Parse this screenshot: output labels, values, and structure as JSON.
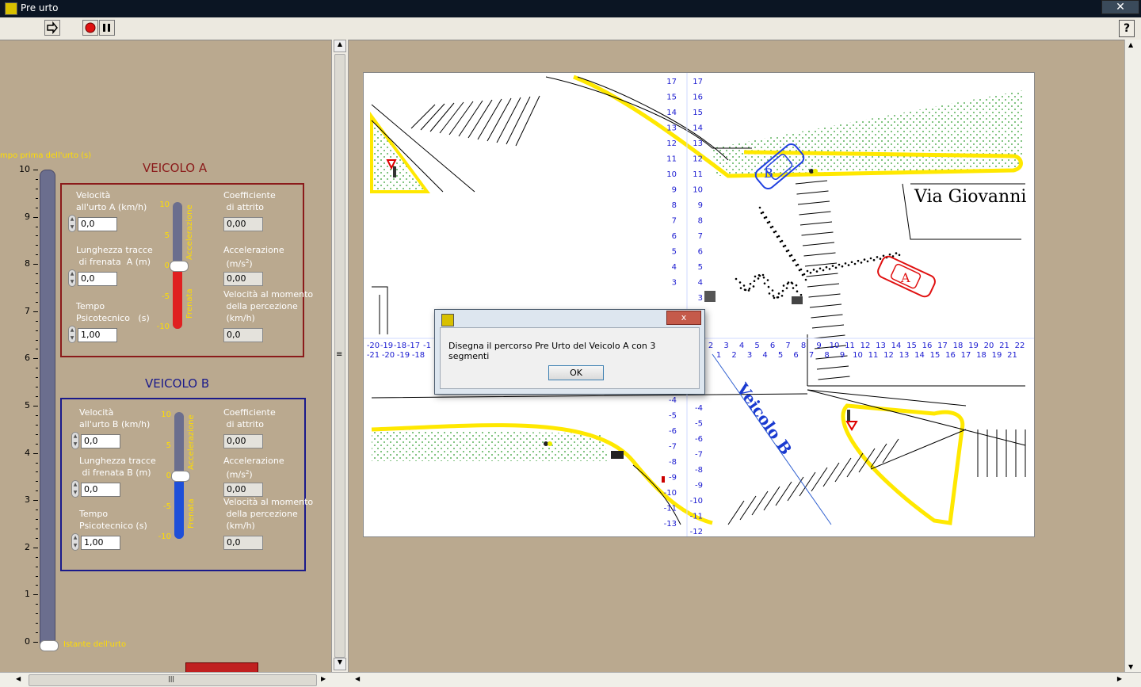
{
  "window": {
    "title": "Pre urto",
    "close_glyph": "✕"
  },
  "toolbar": {
    "run_icon": "run-arrow-icon",
    "stop_icon": "stop-icon",
    "pause_icon": "pause-icon",
    "help_label": "?"
  },
  "time_slider": {
    "label": "mpo prima dell'urto (s)",
    "ticks": [
      "10",
      "9",
      "8",
      "7",
      "6",
      "5",
      "4",
      "3",
      "2",
      "1",
      "0"
    ],
    "value": 0,
    "bottom_label": "Istante dell'urto"
  },
  "veicolo_a": {
    "title": "VEICOLO A",
    "color": "#8b1a1a",
    "vel_label": "Velocità\nall'urto A (km/h)",
    "vel_value": "0,0",
    "len_label": "Lunghezza tracce\n di frenata  A (m)",
    "len_value": "0,0",
    "tempo_label": "Tempo\nPsicotecnico   (s)",
    "tempo_value": "1,00",
    "coef_label": "Coefficiente\n di attrito",
    "coef_value": "0,00",
    "acc_label": "Accelerazione\n (m/s",
    "acc_sup": "2",
    "acc_close": ")",
    "acc_value": "0,00",
    "velperc_label": "Velocità al momento\n della percezione\n (km/h)",
    "velperc_value": "0,0",
    "gauge_ticks": [
      "10",
      "5",
      "0",
      "-5",
      "-10"
    ],
    "gauge_top_label": "Accelerazione",
    "gauge_bottom_label": "Frenata",
    "gauge_fill_color": "#e02020",
    "gauge_value": 0
  },
  "veicolo_b": {
    "title": "VEICOLO B",
    "color": "#1a1a8b",
    "vel_label": "Velocità\nall'urto B (km/h)",
    "vel_value": "0,0",
    "len_label": "Lunghezza tracce\n di frenata B (m)",
    "len_value": "0,0",
    "tempo_label": "Tempo\nPsicotecnico (s)",
    "tempo_value": "1,00",
    "coef_label": "Coefficiente\n di attrito",
    "coef_value": "0,00",
    "acc_label": "Accelerazione\n (m/s",
    "acc_sup": "2",
    "acc_close": ")",
    "acc_value": "0,00",
    "velperc_label": "Velocità al momento\n della percezione\n (km/h)",
    "velperc_value": "0,0",
    "gauge_ticks": [
      "10",
      "5",
      "0",
      "-5",
      "-10"
    ],
    "gauge_top_label": "Accelerazione",
    "gauge_bottom_label": "Frenata",
    "gauge_fill_color": "#1e4fd8",
    "gauge_value": 0
  },
  "map": {
    "street_label": "Via Giovanni",
    "veicolo_b_label": "Veicolo B",
    "car_a_label": "A",
    "car_b_label": "B",
    "axis_top_left": [
      "17",
      "15",
      "14",
      "13",
      "12",
      "11",
      "10",
      "9",
      "8",
      "7",
      "6",
      "5",
      "4",
      "3"
    ],
    "axis_top_right": [
      "17",
      "16",
      "15",
      "14",
      "13",
      "12",
      "11",
      "10",
      "9",
      "8",
      "7",
      "6",
      "5",
      "4",
      "3"
    ],
    "axis_bottom_left": [
      "-4",
      "-5",
      "-6",
      "-7",
      "-8",
      "-9",
      "-10",
      "-11",
      "-13"
    ],
    "axis_bottom_right": [
      "-4",
      "-5",
      "-6",
      "-7",
      "-8",
      "-9",
      "-10",
      "-11",
      "-12"
    ],
    "x_row1_left": [
      "-20",
      "-19",
      "-18",
      "-17",
      "-1"
    ],
    "x_row2_left": [
      "-21",
      "-20",
      "-19",
      "-18"
    ],
    "x_row1_right": [
      "2",
      "3",
      "4",
      "5",
      "6",
      "7",
      "8",
      "9",
      "10",
      "11",
      "12",
      "13",
      "14",
      "15",
      "16",
      "17",
      "18",
      "19",
      "20",
      "21",
      "22"
    ],
    "x_row2_right": [
      "1",
      "2",
      "3",
      "4",
      "5",
      "6",
      "7",
      "8",
      "9",
      "10",
      "11",
      "12",
      "13",
      "14",
      "15",
      "16",
      "17",
      "18",
      "19",
      "21"
    ]
  },
  "dialog": {
    "message": "Disegna il percorso Pre Urto del Veicolo A con 3 segmenti",
    "ok_label": "OK",
    "close_glyph": "x"
  },
  "scrollbars": {
    "grip": "≡",
    "hgrip": "|||"
  }
}
